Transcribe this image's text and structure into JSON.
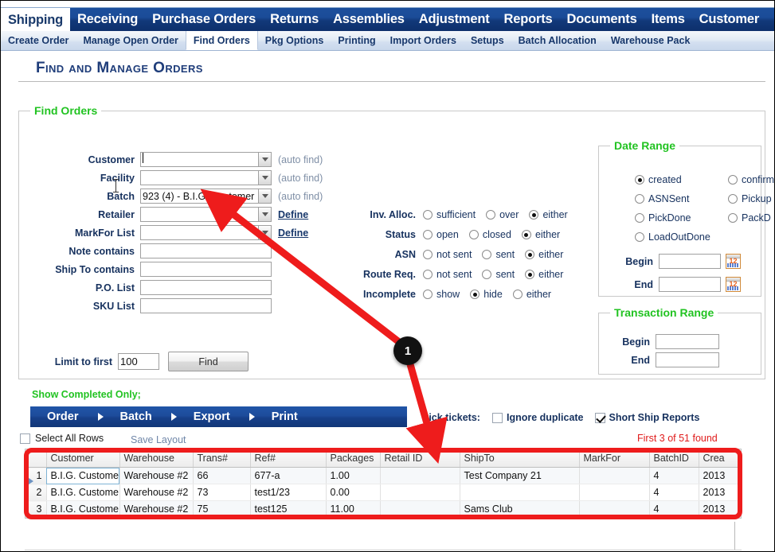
{
  "nav": {
    "tabs": [
      {
        "label": "Shipping",
        "active": true
      },
      {
        "label": "Receiving",
        "active": false
      },
      {
        "label": "Purchase Orders",
        "active": false
      },
      {
        "label": "Returns",
        "active": false
      },
      {
        "label": "Assemblies",
        "active": false
      },
      {
        "label": "Adjustment",
        "active": false
      },
      {
        "label": "Reports",
        "active": false
      },
      {
        "label": "Documents",
        "active": false
      },
      {
        "label": "Items",
        "active": false
      },
      {
        "label": "Customer",
        "active": false
      }
    ],
    "subtabs": [
      {
        "label": "Create Order",
        "active": false
      },
      {
        "label": "Manage Open Order",
        "active": false
      },
      {
        "label": "Find Orders",
        "active": true
      },
      {
        "label": "Pkg Options",
        "active": false
      },
      {
        "label": "Printing",
        "active": false
      },
      {
        "label": "Import Orders",
        "active": false
      },
      {
        "label": "Setups",
        "active": false
      },
      {
        "label": "Batch Allocation",
        "active": false
      },
      {
        "label": "Warehouse Pack",
        "active": false
      }
    ]
  },
  "page": {
    "title": "Find and Manage Orders"
  },
  "find_orders": {
    "legend": "Find Orders",
    "fields": [
      {
        "label": "Customer",
        "value": "",
        "hint": "(auto find)",
        "type": "combo"
      },
      {
        "label": "Facility",
        "value": "",
        "hint": "(auto find)",
        "type": "combo"
      },
      {
        "label": "Batch",
        "value": "923 (4) - B.I.G. Customer",
        "hint": "(auto find)",
        "type": "combo"
      },
      {
        "label": "Retailer",
        "value": "",
        "hint": "Define",
        "type": "combo"
      },
      {
        "label": "MarkFor List",
        "value": "",
        "hint": "Define",
        "type": "combo"
      },
      {
        "label": "Note contains",
        "value": "",
        "hint": "",
        "type": "text"
      },
      {
        "label": "Ship To contains",
        "value": "",
        "hint": "",
        "type": "text"
      },
      {
        "label": "P.O. List",
        "value": "",
        "hint": "",
        "type": "text"
      },
      {
        "label": "SKU List",
        "value": "",
        "hint": "",
        "type": "text"
      }
    ],
    "limit_label": "Limit to first",
    "limit_value": "100",
    "find_button": "Find"
  },
  "filters": [
    {
      "label": "Inv. Alloc.",
      "options": [
        {
          "text": "sufficient",
          "selected": false
        },
        {
          "text": "over",
          "selected": false
        },
        {
          "text": "either",
          "selected": true
        }
      ]
    },
    {
      "label": "Status",
      "options": [
        {
          "text": "open",
          "selected": false
        },
        {
          "text": "closed",
          "selected": false
        },
        {
          "text": "either",
          "selected": true
        }
      ]
    },
    {
      "label": "ASN",
      "options": [
        {
          "text": "not sent",
          "selected": false
        },
        {
          "text": "sent",
          "selected": false
        },
        {
          "text": "either",
          "selected": true
        }
      ]
    },
    {
      "label": "Route Req.",
      "options": [
        {
          "text": "not sent",
          "selected": false
        },
        {
          "text": "sent",
          "selected": false
        },
        {
          "text": "either",
          "selected": true
        }
      ]
    },
    {
      "label": "Incomplete",
      "options": [
        {
          "text": "show",
          "selected": false
        },
        {
          "text": "hide",
          "selected": true
        },
        {
          "text": "either",
          "selected": false
        }
      ]
    }
  ],
  "date_range": {
    "legend": "Date Range",
    "options_left": [
      {
        "text": "created",
        "selected": true
      },
      {
        "text": "ASNSent",
        "selected": false
      },
      {
        "text": "PickDone",
        "selected": false
      },
      {
        "text": "LoadOutDone",
        "selected": false
      }
    ],
    "options_right": [
      {
        "text": "confirm",
        "selected": false
      },
      {
        "text": "Pickup",
        "selected": false
      },
      {
        "text": "PackD",
        "selected": false
      }
    ],
    "begin_label": "Begin",
    "begin_value": "",
    "end_label": "End",
    "end_value": "",
    "calendar_day": "12"
  },
  "transaction_range": {
    "legend": "Transaction Range",
    "begin_label": "Begin",
    "begin_value": "",
    "end_label": "End",
    "end_value": ""
  },
  "results_toolbar": {
    "show_completed": "Show Completed Only;",
    "actions": [
      "Order",
      "Batch",
      "Export",
      "Print"
    ],
    "select_all": "Select All Rows",
    "save_layout": "Save Layout",
    "pick_tickets_label": "Pick tickets:",
    "ignore_duplicate": "Ignore duplicate",
    "ignore_duplicate_checked": false,
    "short_ship_reports": "Short Ship Reports",
    "short_ship_reports_checked": true,
    "found_note": "First 3 of 51 found"
  },
  "grid": {
    "columns": [
      "",
      "Customer",
      "Warehouse",
      "Trans#",
      "Ref#",
      "Packages",
      "Retail ID",
      "ShipTo",
      "MarkFor",
      "BatchID",
      "Crea"
    ],
    "rows": [
      {
        "num": "1",
        "customer": "B.I.G. Custome",
        "warehouse": "Warehouse #2",
        "trans": "66",
        "ref": "677-a",
        "packages": "1.00",
        "retail_id": "",
        "shipto": "Test Company 21",
        "markfor": "",
        "batchid": "4",
        "created": "2013"
      },
      {
        "num": "2",
        "customer": "B.I.G. Custome",
        "warehouse": "Warehouse #2",
        "trans": "73",
        "ref": "test1/23",
        "packages": "0.00",
        "retail_id": "",
        "shipto": "",
        "markfor": "",
        "batchid": "4",
        "created": "2013"
      },
      {
        "num": "3",
        "customer": "B.I.G. Custome",
        "warehouse": "Warehouse #2",
        "trans": "75",
        "ref": "test125",
        "packages": "11.00",
        "retail_id": "",
        "shipto": "Sams Club",
        "markfor": "",
        "batchid": "4",
        "created": "2013"
      }
    ]
  },
  "annotation": {
    "badge_number": "1",
    "accent_color": "#ee1c1c"
  }
}
